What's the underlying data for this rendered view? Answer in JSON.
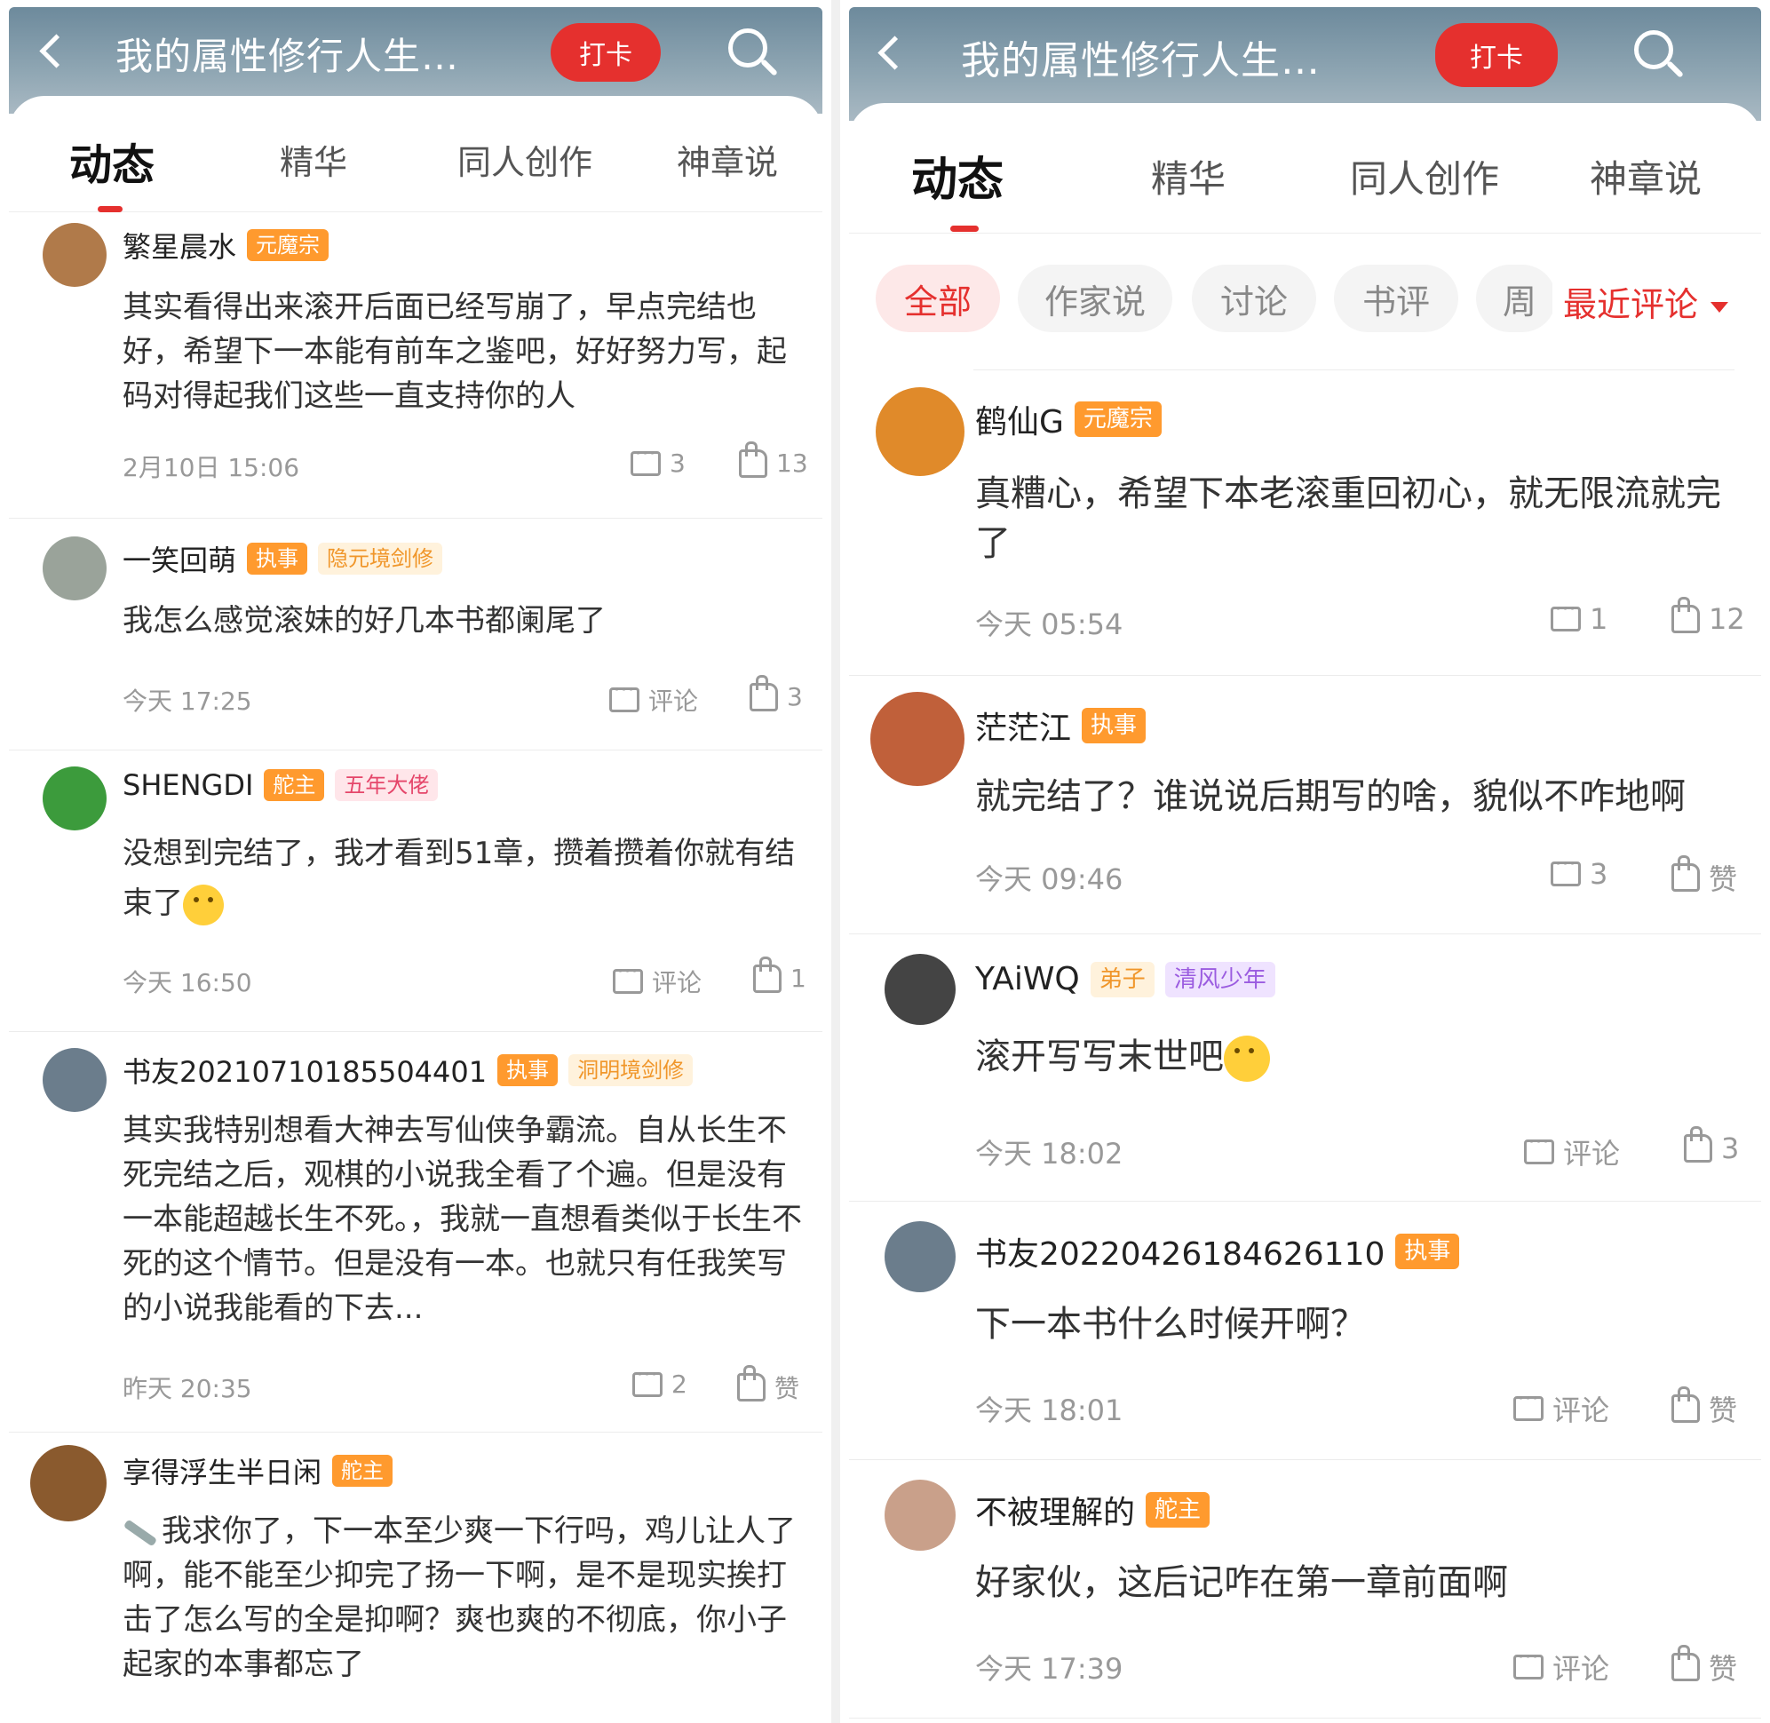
{
  "left": {
    "header": {
      "title": "我的属性修行人生…",
      "checkin": "打卡"
    },
    "tabs": [
      "动态",
      "精华",
      "同人创作",
      "神章说"
    ],
    "comments": [
      {
        "name": "繁星晨水",
        "badges": [
          {
            "text": "元魔宗",
            "style": "orange"
          }
        ],
        "text": "其实看得出来滚开后面已经写崩了，早点完结也好，希望下一本能有前车之鉴吧，好好努力写，起码对得起我们这些一直支持你的人",
        "time": "2月10日 15:06",
        "comments": "3",
        "likes": "13",
        "avatar": "#b07a4a"
      },
      {
        "name": "一笑回萌",
        "badges": [
          {
            "text": "执事",
            "style": "orange"
          },
          {
            "text": "隐元境剑修",
            "style": "gold"
          }
        ],
        "text": "我怎么感觉滚妹的好几本书都阑尾了",
        "time": "今天 17:25",
        "comments": "评论",
        "likes": "3",
        "avatar": "#9aa39a"
      },
      {
        "name": "SHENGDI",
        "badges": [
          {
            "text": "舵主",
            "style": "orange"
          },
          {
            "text": "五年大佬",
            "style": "pink"
          }
        ],
        "text": "没想到完结了，我才看到51章，攒着攒着你就有结束了",
        "time": "今天 16:50",
        "comments": "评论",
        "likes": "1",
        "avatar": "#3c9b3c"
      },
      {
        "name": "书友20210710185504401",
        "badges": [
          {
            "text": "执事",
            "style": "orange"
          },
          {
            "text": "洞明境剑修",
            "style": "gold"
          }
        ],
        "text": "其实我特别想看大神去写仙侠争霸流。自从长生不死完结之后，观棋的小说我全看了个遍。但是没有一本能超越长生不死。，我就一直想看类似于长生不死的这个情节。但是没有一本。也就只有任我笑写的小说我能看的下去...",
        "time": "昨天 20:35",
        "comments": "2",
        "likes": "赞",
        "avatar": "#6b7d8c"
      },
      {
        "name": "享得浮生半日闲",
        "badges": [
          {
            "text": "舵主",
            "style": "orange"
          }
        ],
        "text": "我求你了，下一本至少爽一下行吗，鸡儿让人了啊，能不能至少抑完了扬一下啊，是不是现实挨打击了怎么写的全是抑啊？爽也爽的不彻底，你小子起家的本事都忘了",
        "time": "",
        "comments": "",
        "likes": "",
        "avatar": "#8a5a2e"
      }
    ]
  },
  "right": {
    "header": {
      "title": "我的属性修行人生…",
      "checkin": "打卡"
    },
    "tabs": [
      "动态",
      "精华",
      "同人创作",
      "神章说"
    ],
    "chips": [
      "全部",
      "作家说",
      "讨论",
      "书评",
      "周"
    ],
    "sort": "最近评论",
    "comments": [
      {
        "name": "鹤仙G",
        "badges": [
          {
            "text": "元魔宗",
            "style": "orange"
          }
        ],
        "text": "真糟心，希望下本老滚重回初心，就无限流就完了",
        "time": "今天 05:54",
        "comments": "1",
        "likes": "12",
        "avatar": "#e08a2a"
      },
      {
        "name": "茫茫江",
        "badges": [
          {
            "text": "执事",
            "style": "orange"
          }
        ],
        "text": "就完结了？谁说说后期写的啥，貌似不咋地啊",
        "time": "今天 09:46",
        "comments": "3",
        "likes": "赞",
        "avatar": "#c0603a"
      },
      {
        "name": "YAiWQ",
        "badges": [
          {
            "text": "弟子",
            "style": "gold"
          },
          {
            "text": "清风少年",
            "style": "purple"
          }
        ],
        "text": "滚开写写末世吧",
        "time": "今天 18:02",
        "comments": "评论",
        "likes": "3",
        "avatar": "#444"
      },
      {
        "name": "书友20220426184626110",
        "badges": [
          {
            "text": "执事",
            "style": "orange"
          }
        ],
        "text": "下一本书什么时候开啊？",
        "time": "今天 18:01",
        "comments": "评论",
        "likes": "赞",
        "avatar": "#6b7d8c"
      },
      {
        "name": "不被理解的",
        "badges": [
          {
            "text": "舵主",
            "style": "orange"
          }
        ],
        "text": "好家伙，这后记咋在第一章前面啊",
        "time": "今天 17:39",
        "comments": "评论",
        "likes": "赞",
        "avatar": "#c9a08a"
      }
    ]
  }
}
